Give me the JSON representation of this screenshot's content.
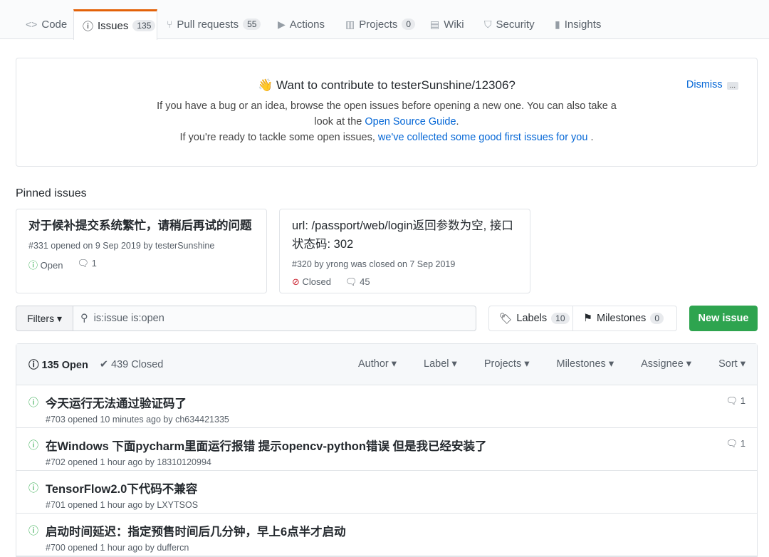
{
  "tabs": [
    {
      "label": "Code",
      "icon": "code-icon",
      "glyph": "<>"
    },
    {
      "label": "Issues",
      "count": "135",
      "icon": "issue-icon",
      "glyph": "ⓘ",
      "selected": true
    },
    {
      "label": "Pull requests",
      "count": "55",
      "icon": "pull-request-icon",
      "glyph": "⑂"
    },
    {
      "label": "Actions",
      "icon": "play-icon",
      "glyph": "▶"
    },
    {
      "label": "Projects",
      "count": "0",
      "icon": "project-icon",
      "glyph": "▥"
    },
    {
      "label": "Wiki",
      "icon": "book-icon",
      "glyph": "▤"
    },
    {
      "label": "Security",
      "icon": "shield-icon",
      "glyph": "⛉"
    },
    {
      "label": "Insights",
      "icon": "graph-icon",
      "glyph": "▮"
    }
  ],
  "banner": {
    "emoji": "👋",
    "title": "Want to contribute to testerSunshine/12306?",
    "line1": "If you have a bug or an idea, browse the open issues before opening a new one. You can also take a",
    "line2_pre": "look at the ",
    "line2_link": "Open Source Guide",
    "line2_post": ".",
    "line3_pre": "If you're ready to tackle some open issues, ",
    "line3_link": "we've collected some good first issues for you",
    "line3_post": " .",
    "dismiss": "Dismiss",
    "more": "..."
  },
  "pinned": {
    "label": "Pinned issues",
    "items": [
      {
        "title": "对于候补提交系统繁忙，请稍后再试的问题",
        "meta": "#331 opened on 9 Sep 2019 by testerSunshine",
        "state": "Open",
        "comments": "1"
      },
      {
        "title": "url: /passport/web/login返回参数为空, 接口状态码: 302",
        "meta": "#320 by yrong was closed on 7 Sep 2019",
        "state": "Closed",
        "comments": "45"
      }
    ]
  },
  "toolbar": {
    "filters": "Filters ▾",
    "search_value": "is:issue is:open",
    "labels": "Labels",
    "labels_count": "10",
    "milestones": "Milestones",
    "milestones_count": "0",
    "new_issue": "New issue"
  },
  "list": {
    "open": "135 Open",
    "closed": "439 Closed",
    "sorts": [
      "Author ▾",
      "Label ▾",
      "Projects ▾",
      "Milestones ▾",
      "Assignee ▾",
      "Sort ▾"
    ],
    "issues": [
      {
        "title": "今天运行无法通过验证码了",
        "meta": "#703 opened 10 minutes ago by ch634421335",
        "comments": "1"
      },
      {
        "title": "在Windows 下面pycharm里面运行报错 提示opencv-python错误 但是我已经安装了",
        "meta": "#702 opened 1 hour ago by 18310120994",
        "comments": "1"
      },
      {
        "title": "TensorFlow2.0下代码不兼容",
        "meta": "#701 opened 1 hour ago by LXYTSOS",
        "comments": ""
      },
      {
        "title": "启动时间延迟：指定预售时间后几分钟，早上6点半才启动",
        "meta": "#700 opened 1 hour ago by duffercn",
        "comments": ""
      }
    ]
  },
  "colors": {
    "accent": "#e36209",
    "open": "#28a745",
    "closed": "#cb2431",
    "link": "#0366d6",
    "new_button": "#2ea44f"
  }
}
